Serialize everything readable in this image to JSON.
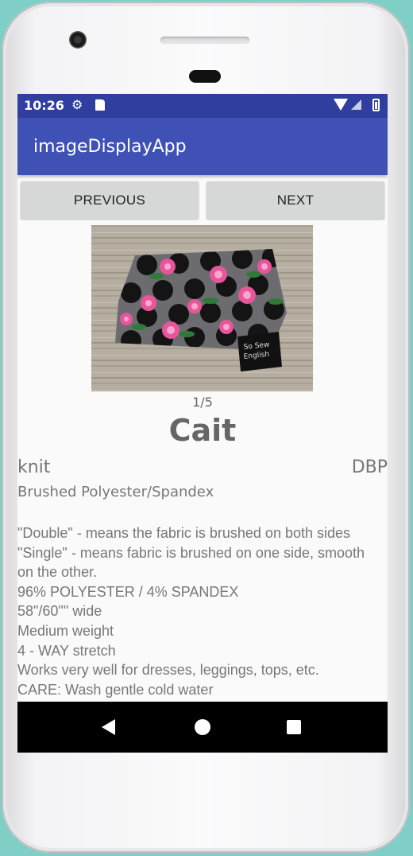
{
  "status_bar": {
    "time": "10:26",
    "icons": [
      "gear-icon",
      "sd-card-icon",
      "wifi-icon",
      "signal-icon",
      "battery-icon"
    ]
  },
  "app_bar": {
    "title": "imageDisplayApp"
  },
  "buttons": {
    "previous": "PREVIOUS",
    "next": "NEXT"
  },
  "image": {
    "counter": "1/5",
    "tag_text_line1": "So Sew",
    "tag_text_line2": "English"
  },
  "fabric": {
    "name": "Cait",
    "type": "knit",
    "code": "DBP",
    "material": "Brushed Polyester/Spandex",
    "description": "\"Double\" - means the fabric is brushed on both sides\n\"Single\" - means fabric is brushed on one side, smooth on the other.\n96% POLYESTER / 4% SPANDEX\n58\"/60\"\" wide\nMedium weight\n4 - WAY stretch\nWorks very well for dresses, leggings, tops, etc.\nCARE: Wash gentle cold water"
  },
  "colors": {
    "status_bar": "#303f9f",
    "app_bar": "#3f51b5",
    "button_bg": "#d6d7d7",
    "screen_bg": "#fafafa"
  },
  "nav_bar": {
    "icons": [
      "back-icon",
      "home-icon",
      "recents-icon"
    ]
  }
}
